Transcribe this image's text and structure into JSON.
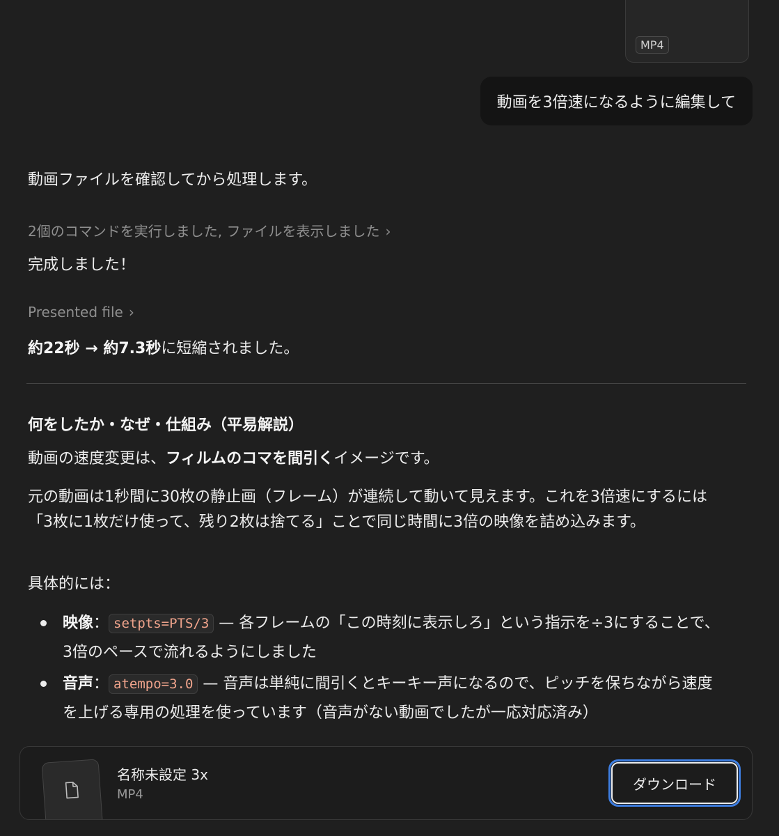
{
  "attachment": {
    "type_badge": "MP4"
  },
  "user_message": "動画を3倍速になるように編集して",
  "assistant": {
    "intro": "動画ファイルを確認してから処理します。",
    "tool_summary": "2個のコマンドを実行しました, ファイルを表示しました",
    "done": "完成しました！",
    "presented_file": "Presented file",
    "result_bold_1": "約22秒 → 約7.3秒",
    "result_rest": "に短縮されました。",
    "heading": "何をしたか・なぜ・仕組み（平易解説）",
    "p1_prefix": "動画の速度変更は、",
    "p1_bold": "フィルムのコマを間引く",
    "p1_suffix": "イメージです。",
    "p2": "元の動画は1秒間に30枚の静止画（フレーム）が連続して動いて見えます。これを3倍速にするには「3枚に1枚だけ使って、残り2枚は捨てる」ことで同じ時間に3倍の映像を詰め込みます。",
    "p3": "具体的には：",
    "bullets": [
      {
        "label": "映像",
        "colon": "：",
        "code": "setpts=PTS/3",
        "text": " — 各フレームの「この時刻に表示しろ」という指示を÷3にすることで、3倍のペースで流れるようにしました"
      },
      {
        "label": "音声",
        "colon": "：",
        "code": "atempo=3.0",
        "text": " — 音声は単純に間引くとキーキー声になるので、ピッチを保ちながら速度を上げる専用の処理を使っています（音声がない動画でしたが一応対応済み）"
      }
    ]
  },
  "file_card": {
    "name": "名称未設定 3x",
    "type": "MP4",
    "download_label": "ダウンロード"
  },
  "colors": {
    "background": "#1f1f1f",
    "user_bubble": "#141414",
    "code_text": "#f0a48c",
    "focus_ring": "#3d7de0"
  }
}
